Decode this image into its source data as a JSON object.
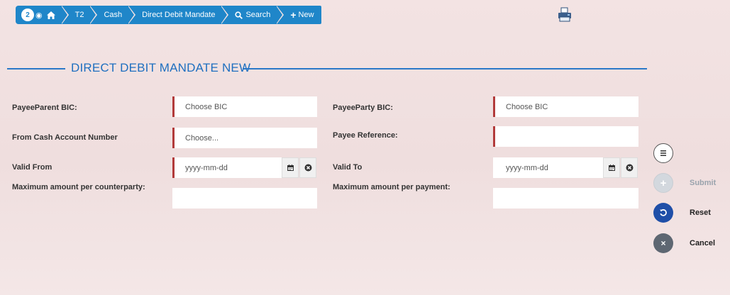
{
  "breadcrumb": {
    "badge_count": "2",
    "items": [
      "T2",
      "Cash",
      "Direct Debit Mandate",
      "Search",
      "New"
    ]
  },
  "page": {
    "title": "DIRECT DEBIT MANDATE NEW"
  },
  "form": {
    "payee_parent_bic": {
      "label": "PayeeParent BIC:",
      "placeholder": "Choose BIC"
    },
    "payee_party_bic": {
      "label": "PayeeParty BIC:",
      "placeholder": "Choose BIC"
    },
    "from_cash_account": {
      "label": "From Cash Account Number",
      "placeholder": "Choose..."
    },
    "payee_reference": {
      "label": "Payee Reference:",
      "placeholder": ""
    },
    "valid_from": {
      "label": "Valid From",
      "placeholder": "yyyy-mm-dd"
    },
    "valid_to": {
      "label": "Valid To",
      "placeholder": "yyyy-mm-dd"
    },
    "max_per_counterparty": {
      "label": "Maximum amount per counterparty:",
      "placeholder": ""
    },
    "max_per_payment": {
      "label": "Maximum amount per payment:",
      "placeholder": ""
    }
  },
  "actions": {
    "submit": "Submit",
    "reset": "Reset",
    "cancel": "Cancel"
  },
  "colors": {
    "accent": "#1f86c9",
    "title": "#1f6fc0",
    "required_marker": "#b23b3b",
    "reset_button": "#1f4fa8",
    "cancel_button": "#5e6772",
    "disabled": "#d3d8de"
  },
  "icons": [
    "eye-icon",
    "home-icon",
    "search-icon",
    "plus-icon",
    "printer-icon",
    "calendar-icon",
    "clear-icon",
    "list-icon",
    "submit-plus-icon",
    "reset-icon",
    "cancel-x-icon"
  ]
}
